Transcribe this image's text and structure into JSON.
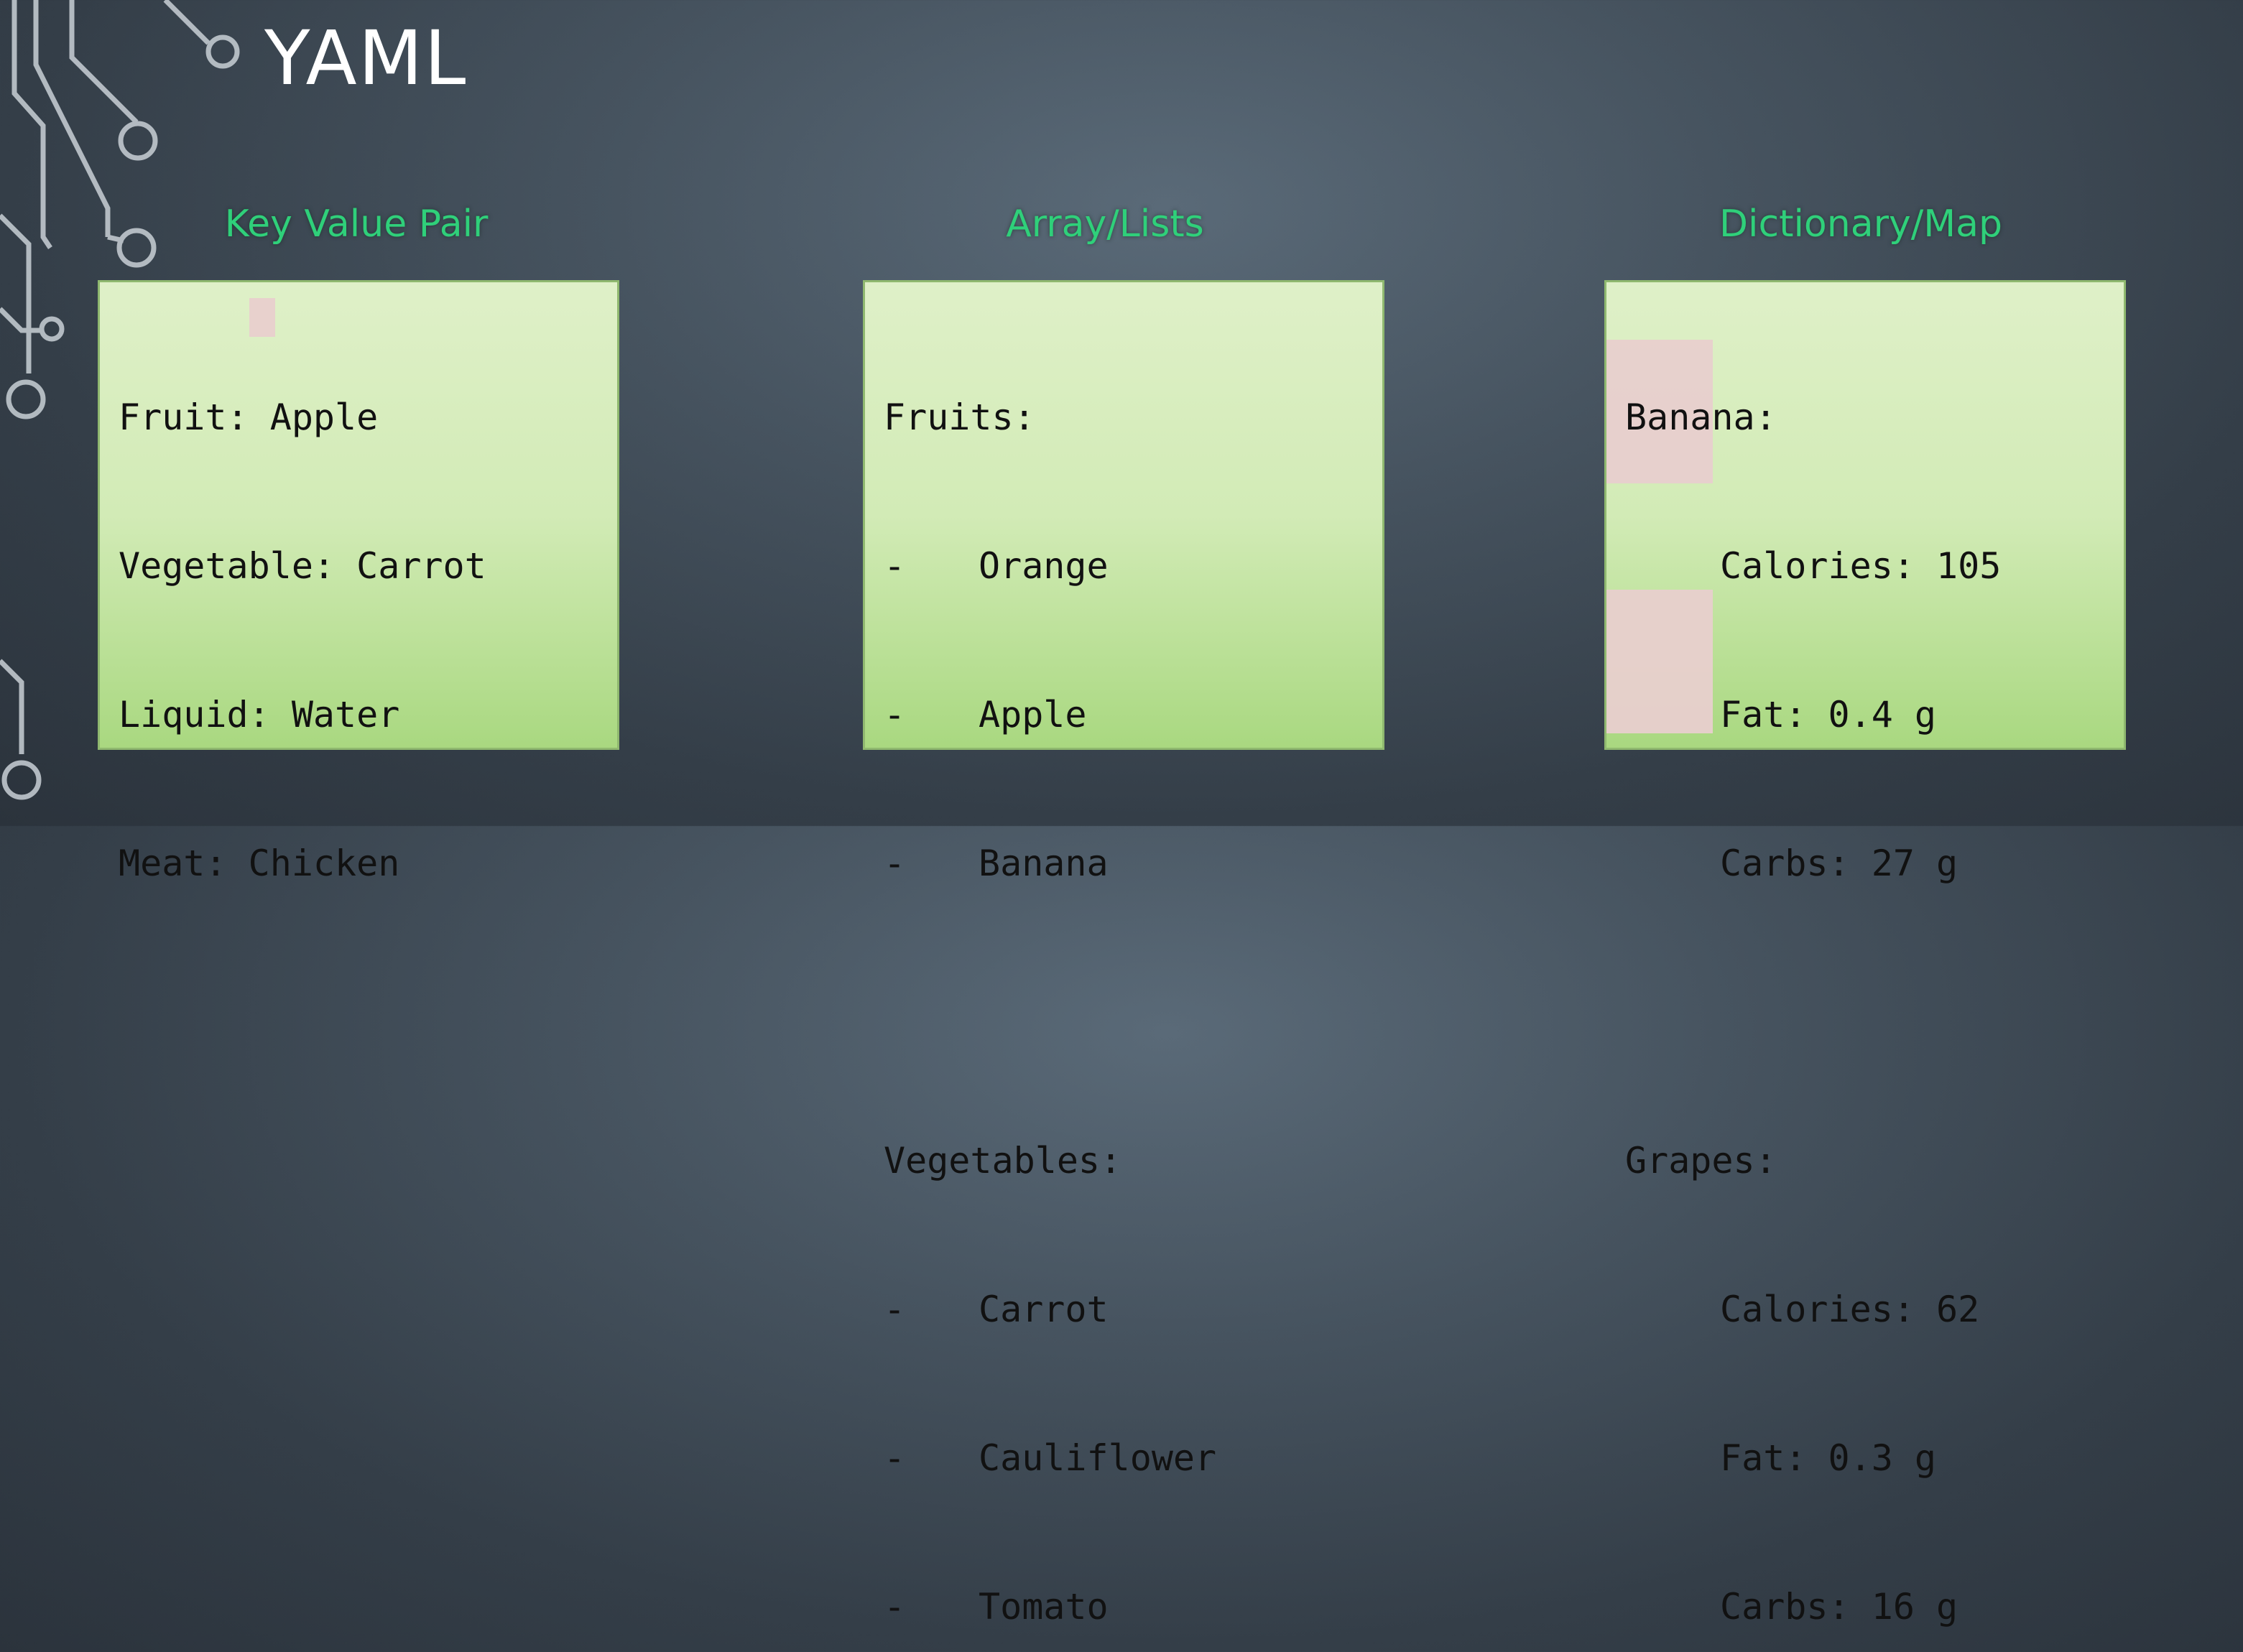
{
  "slide": {
    "title": "YAML"
  },
  "columns": [
    {
      "heading": "Key Value Pair",
      "lines": [
        "Fruit: Apple",
        "Vegetable: Carrot",
        "Liquid: Water",
        "Meat: Chicken"
      ]
    },
    {
      "heading": "Array/Lists",
      "groups": [
        {
          "key": "Fruits:",
          "items": [
            "Orange",
            "Apple",
            "Banana"
          ]
        },
        {
          "key": "Vegetables:",
          "items": [
            "Carrot",
            "Cauliflower",
            "Tomato"
          ]
        }
      ]
    },
    {
      "heading": "Dictionary/Map",
      "groups": [
        {
          "key": "Banana:",
          "props": [
            "Calories: 105",
            "Fat: 0.4 g",
            "Carbs: 27 g"
          ]
        },
        {
          "key": "Grapes:",
          "props": [
            "Calories: 62",
            "Fat: 0.3 g",
            "Carbs: 16 g"
          ]
        }
      ]
    }
  ],
  "list_marker": "-",
  "colors": {
    "heading": "#2fd07a",
    "panel": "#d2ebb6",
    "title": "#ffffff",
    "highlight": "#e8cfcd"
  }
}
